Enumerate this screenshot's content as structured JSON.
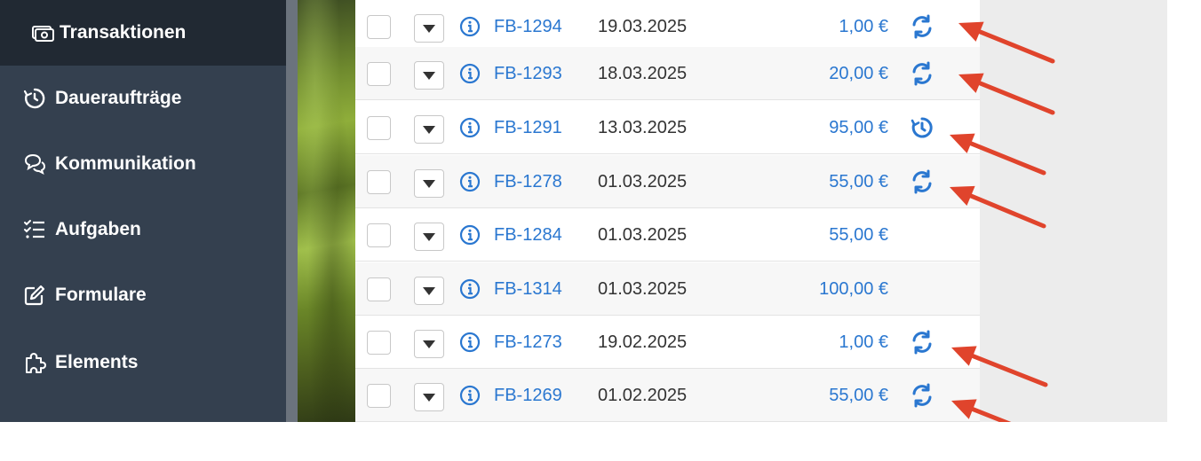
{
  "sidebar": {
    "items": [
      {
        "label": "Transaktionen",
        "icon": "money-icon",
        "active": true
      },
      {
        "label": "Daueraufträge",
        "icon": "recurring-clock-icon"
      },
      {
        "label": "Kommunikation",
        "icon": "chat-bubbles-icon"
      },
      {
        "label": "Aufgaben",
        "icon": "checklist-icon"
      },
      {
        "label": "Formulare",
        "icon": "edit-form-icon"
      },
      {
        "label": "Elements",
        "icon": "puzzle-icon"
      }
    ]
  },
  "transactions": [
    {
      "ref": "FB-1294",
      "date": "19.03.2025",
      "amount": "1,00 €",
      "status": "recurring"
    },
    {
      "ref": "FB-1293",
      "date": "18.03.2025",
      "amount": "20,00 €",
      "status": "recurring"
    },
    {
      "ref": "FB-1291",
      "date": "13.03.2025",
      "amount": "95,00 €",
      "status": "standing-order"
    },
    {
      "ref": "FB-1278",
      "date": "01.03.2025",
      "amount": "55,00 €",
      "status": "recurring"
    },
    {
      "ref": "FB-1284",
      "date": "01.03.2025",
      "amount": "55,00 €",
      "status": "none"
    },
    {
      "ref": "FB-1314",
      "date": "01.03.2025",
      "amount": "100,00 €",
      "status": "none"
    },
    {
      "ref": "FB-1273",
      "date": "19.02.2025",
      "amount": "1,00 €",
      "status": "recurring"
    },
    {
      "ref": "FB-1269",
      "date": "01.02.2025",
      "amount": "55,00 €",
      "status": "recurring"
    }
  ],
  "colors": {
    "sidebar_bg": "#34404f",
    "sidebar_active_bg": "#212933",
    "link_blue": "#2a77d0",
    "annotation_arrow": "#e0442c"
  }
}
